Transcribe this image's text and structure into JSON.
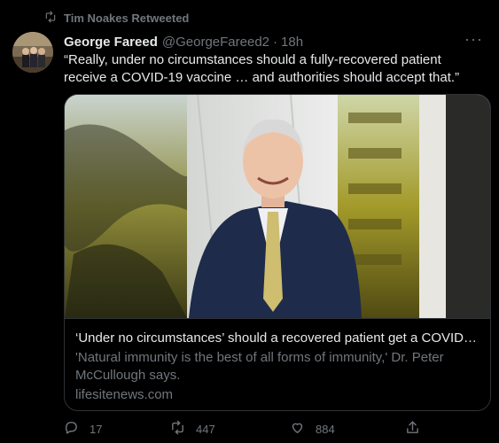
{
  "retweet": {
    "label": "Tim Noakes Retweeted"
  },
  "tweet": {
    "name": "George Fareed",
    "handle": "@GeorgeFareed2",
    "separator": "·",
    "time": "18h",
    "more": "···",
    "text": "“Really, under no circumstances should a fully-recovered patient receive a COVID-19 vaccine … and authorities should accept that.”"
  },
  "card": {
    "title": "‘Under no circumstances’ should a recovered patient get a COVID jab,…",
    "description": "'Natural immunity is the best of all forms of immunity,' Dr. Peter McCullough says.",
    "domain": "lifesitenews.com"
  },
  "actions": {
    "reply_count": "17",
    "retweet_count": "447",
    "like_count": "884",
    "share_count": ""
  },
  "icons": {
    "retweet_indicator": "retweet-icon",
    "reply": "reply-icon",
    "retweet": "retweet-icon",
    "like": "heart-icon",
    "share": "share-icon",
    "more": "more-icon"
  },
  "colors": {
    "background": "#000000",
    "primary_text": "#e7e9ea",
    "secondary_text": "#71767b",
    "border": "#2f3336"
  }
}
